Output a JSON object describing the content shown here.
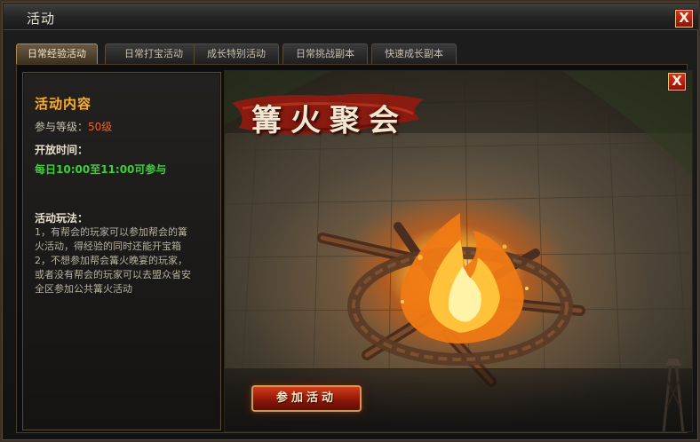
{
  "window": {
    "title": "活动",
    "close_label": "X"
  },
  "tabs": [
    {
      "label": "日常经验活动",
      "active": true
    },
    {
      "label": "日常打宝活动",
      "active": false
    },
    {
      "label": "成长特别活动",
      "active": false
    },
    {
      "label": "日常挑战副本",
      "active": false
    },
    {
      "label": "快速成长副本",
      "active": false
    }
  ],
  "info": {
    "section_title": "活动内容",
    "level_label": "参与等级：",
    "level_value": "50级",
    "open_time_title": "开放时间：",
    "open_time_value": "每日10:00至11:00可参与",
    "play_title": "活动玩法：",
    "play_lines": [
      "1，有帮会的玩家可以参加帮会的篝",
      "火活动，得经验的同时还能开宝箱",
      "2，不想参加帮会篝火晚宴的玩家，",
      "或者没有帮会的玩家可以去盟众省安",
      "全区参加公共篝火活动"
    ]
  },
  "scene": {
    "banner_text": "篝火聚会",
    "close_label": "X",
    "join_button": "参加活动"
  },
  "colors": {
    "accent_gold": "#f0b040",
    "level_red": "#e8622e",
    "time_green": "#3fcf3a",
    "button_red": "#b8240f"
  },
  "icons": {
    "close": "close-icon",
    "campfire": "campfire-illustration",
    "banner": "red-brush-banner"
  }
}
